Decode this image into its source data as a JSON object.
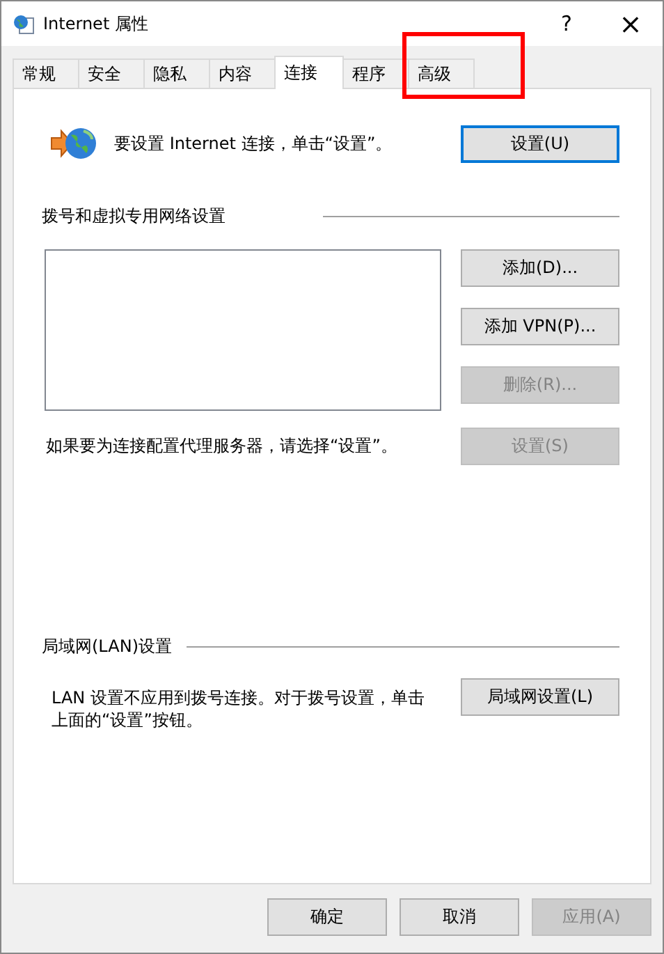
{
  "window": {
    "title": "Internet 属性",
    "help": "?",
    "close": "×"
  },
  "tabs": [
    {
      "label": "常规",
      "selected": false,
      "highlighted": false
    },
    {
      "label": "安全",
      "selected": false,
      "highlighted": false
    },
    {
      "label": "隐私",
      "selected": false,
      "highlighted": false
    },
    {
      "label": "内容",
      "selected": false,
      "highlighted": false
    },
    {
      "label": "连接",
      "selected": true,
      "highlighted": false
    },
    {
      "label": "程序",
      "selected": false,
      "highlighted": false
    },
    {
      "label": "高级",
      "selected": false,
      "highlighted": true
    }
  ],
  "setup": {
    "text": "要设置 Internet 连接，单击“设置”。",
    "button": {
      "label": "设置(U)",
      "default": true
    }
  },
  "dialup": {
    "heading": "拨号和虚拟专用网络设置",
    "buttons": [
      {
        "label": "添加(D)...",
        "disabled": false
      },
      {
        "label": "添加 VPN(P)...",
        "disabled": false
      },
      {
        "label": "删除(R)...",
        "disabled": true
      }
    ],
    "proxy_text": "如果要为连接配置代理服务器，请选择“设置”。",
    "proxy_button": {
      "label": "设置(S)",
      "disabled": true
    }
  },
  "lan": {
    "heading": "局域网(LAN)设置",
    "text": "LAN 设置不应用到拨号连接。对于拨号设置，单击上面的“设置”按钮。",
    "button": {
      "label": "局域网设置(L)",
      "disabled": false
    }
  },
  "footer_buttons": [
    {
      "label": "确定",
      "disabled": false
    },
    {
      "label": "取消",
      "disabled": false
    },
    {
      "label": "应用(A)",
      "disabled": true
    }
  ]
}
